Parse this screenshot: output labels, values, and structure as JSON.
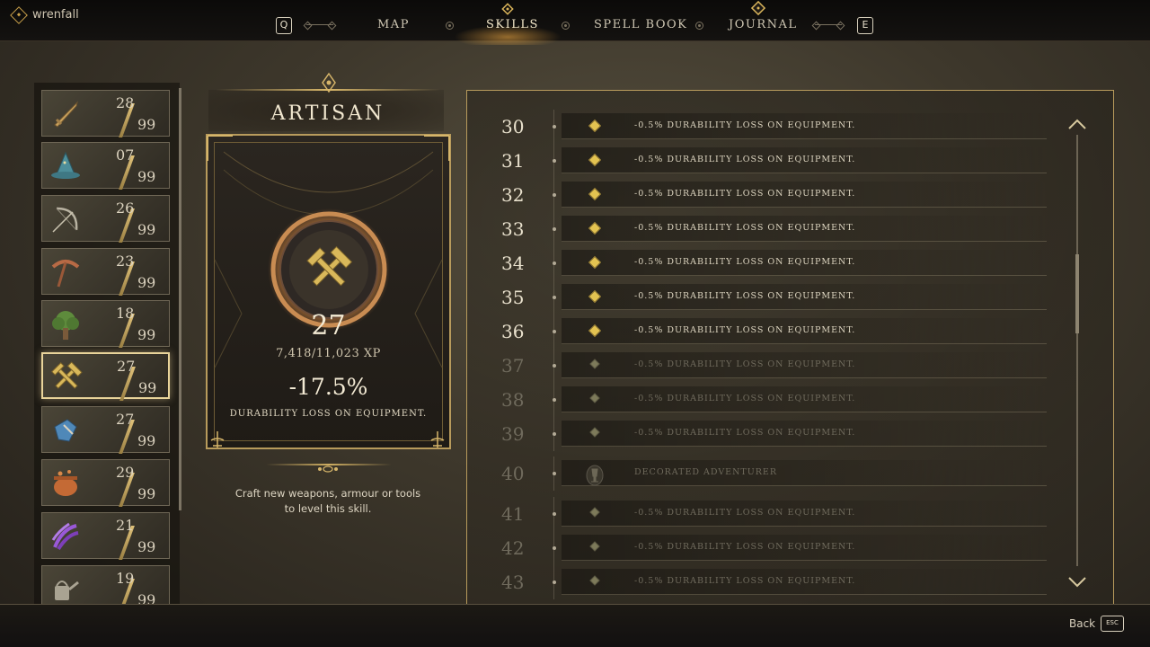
{
  "header": {
    "username": "wrenfall",
    "prev_key": "Q",
    "next_key": "E",
    "tabs": [
      {
        "label": "MAP",
        "active": false
      },
      {
        "label": "SKILLS",
        "active": true
      },
      {
        "label": "SPELL BOOK",
        "active": false
      },
      {
        "label": "JOURNAL",
        "active": false
      }
    ]
  },
  "skills": [
    {
      "icon": "sword-icon",
      "level": "28",
      "max": "99",
      "selected": false
    },
    {
      "icon": "wizard-hat-icon",
      "level": "07",
      "max": "99",
      "selected": false
    },
    {
      "icon": "bow-icon",
      "level": "26",
      "max": "99",
      "selected": false
    },
    {
      "icon": "pickaxe-icon",
      "level": "23",
      "max": "99",
      "selected": false
    },
    {
      "icon": "tree-icon",
      "level": "18",
      "max": "99",
      "selected": false
    },
    {
      "icon": "hammer-icon",
      "level": "27",
      "max": "99",
      "selected": true
    },
    {
      "icon": "gauntlet-icon",
      "level": "27",
      "max": "99",
      "selected": false
    },
    {
      "icon": "cauldron-icon",
      "level": "29",
      "max": "99",
      "selected": false
    },
    {
      "icon": "magic-claw-icon",
      "level": "21",
      "max": "99",
      "selected": false
    },
    {
      "icon": "watering-can-icon",
      "level": "19",
      "max": "99",
      "selected": false
    }
  ],
  "detail": {
    "title": "ARTISAN",
    "level": "27",
    "xp": "7,418/11,023 XP",
    "bonus": "-17.5%",
    "effect": "DURABILITY LOSS ON EQUIPMENT.",
    "description": "Craft new weapons, armour or tools to level this skill."
  },
  "levels": [
    {
      "level": "30",
      "text": "-0.5% DURABILITY LOSS ON EQUIPMENT.",
      "unlocked": true
    },
    {
      "level": "31",
      "text": "-0.5% DURABILITY LOSS ON EQUIPMENT.",
      "unlocked": true
    },
    {
      "level": "32",
      "text": "-0.5% DURABILITY LOSS ON EQUIPMENT.",
      "unlocked": true
    },
    {
      "level": "33",
      "text": "-0.5% DURABILITY LOSS ON EQUIPMENT.",
      "unlocked": true
    },
    {
      "level": "34",
      "text": "-0.5% DURABILITY LOSS ON EQUIPMENT.",
      "unlocked": true
    },
    {
      "level": "35",
      "text": "-0.5% DURABILITY LOSS ON EQUIPMENT.",
      "unlocked": true
    },
    {
      "level": "36",
      "text": "-0.5% DURABILITY LOSS ON EQUIPMENT.",
      "unlocked": true
    },
    {
      "level": "37",
      "text": "-0.5% DURABILITY LOSS ON EQUIPMENT.",
      "unlocked": false
    },
    {
      "level": "38",
      "text": "-0.5% DURABILITY LOSS ON EQUIPMENT.",
      "unlocked": false
    },
    {
      "level": "39",
      "text": "-0.5% DURABILITY LOSS ON EQUIPMENT.",
      "unlocked": false
    },
    {
      "level": "40",
      "text": "DECORATED ADVENTURER",
      "unlocked": false,
      "milestone": true
    },
    {
      "level": "41",
      "text": "-0.5% DURABILITY LOSS ON EQUIPMENT.",
      "unlocked": false
    },
    {
      "level": "42",
      "text": "-0.5% DURABILITY LOSS ON EQUIPMENT.",
      "unlocked": false
    },
    {
      "level": "43",
      "text": "-0.5% DURABILITY LOSS ON EQUIPMENT.",
      "unlocked": false
    }
  ],
  "footer": {
    "back_label": "Back",
    "back_key": "ESC"
  },
  "colors": {
    "accent_gold": "#e3c351",
    "frame_gold": "#b89b5c",
    "background": "#3d372b"
  }
}
